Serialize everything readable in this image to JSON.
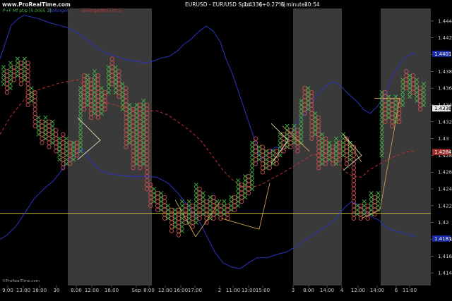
{
  "header": {
    "site": "www.ProRealTime.com",
    "title": "EURUSD - EUR/USD Spot",
    "price": "1.4336",
    "change": "(+0.27%)",
    "interval": "5 minutes",
    "time": "20:54"
  },
  "legend": {
    "pf": "P+F Mf pt/p [0.0005 3]",
    "bands": "Bollinger ...",
    "mid": "BollingerMid [20.2]"
  },
  "watermark": "©ProRealTime.com",
  "colors": {
    "x_mark": "#4ab44a",
    "o_mark": "#c85050",
    "upper_band": "#2a34c0",
    "lower_band": "#2a34c0",
    "mid_band": "#c03030",
    "shade": "#3a3a3a",
    "hline": "#b8b23a",
    "trendline": "#c8a050",
    "wedge": "#d8d8a8"
  },
  "chart_data": {
    "type": "point-and-figure",
    "ylim": [
      1.4125,
      1.4455
    ],
    "yticks": [
      1.414,
      1.416,
      1.418,
      1.42,
      1.422,
      1.424,
      1.426,
      1.428,
      1.43,
      1.432,
      1.434,
      1.436,
      1.438,
      1.44,
      1.442,
      1.444
    ],
    "ytick_labels": [
      "1.414",
      "1.416",
      "1.418",
      "1.42",
      "1.422",
      "1.424",
      "1.426",
      "1.428",
      "1.43",
      "1.432",
      "1.434",
      "1.436",
      "1.438",
      "1.44",
      "1.442",
      "1.444"
    ],
    "xlabels": [
      "9:00",
      "13:00",
      "18:00",
      "30",
      "8:00",
      "12:00",
      "16:00",
      "Sep",
      "8:00",
      "12:00",
      "16:00",
      "17:00",
      "2",
      "11:00",
      "13:00",
      "15:00",
      "3",
      "8:00",
      "14:00",
      "4",
      "12:00",
      "14:00",
      "6",
      "11:00"
    ],
    "price_labels": {
      "upper_band": "1.4401",
      "last": "1.4336",
      "mid": "1.4284",
      "lower_band": "1.4181"
    },
    "hline": 1.4211,
    "box": 0.0005,
    "columns": [
      {
        "t": "X",
        "lo": 1.4365,
        "hi": 1.4385
      },
      {
        "t": "O",
        "lo": 1.4355,
        "hi": 1.438
      },
      {
        "t": "X",
        "lo": 1.436,
        "hi": 1.439
      },
      {
        "t": "O",
        "lo": 1.437,
        "hi": 1.4385
      },
      {
        "t": "X",
        "lo": 1.4375,
        "hi": 1.4395
      },
      {
        "t": "O",
        "lo": 1.4365,
        "hi": 1.439
      },
      {
        "t": "X",
        "lo": 1.437,
        "hi": 1.4395
      },
      {
        "t": "O",
        "lo": 1.434,
        "hi": 1.439
      },
      {
        "t": "X",
        "lo": 1.4345,
        "hi": 1.436
      },
      {
        "t": "O",
        "lo": 1.4315,
        "hi": 1.4355
      },
      {
        "t": "X",
        "lo": 1.4305,
        "hi": 1.4325
      },
      {
        "t": "O",
        "lo": 1.4295,
        "hi": 1.432
      },
      {
        "t": "X",
        "lo": 1.43,
        "hi": 1.4325
      },
      {
        "t": "O",
        "lo": 1.429,
        "hi": 1.432
      },
      {
        "t": "X",
        "lo": 1.4295,
        "hi": 1.432
      },
      {
        "t": "O",
        "lo": 1.4285,
        "hi": 1.431
      },
      {
        "t": "X",
        "lo": 1.4275,
        "hi": 1.43
      },
      {
        "t": "O",
        "lo": 1.4265,
        "hi": 1.4305
      },
      {
        "t": "X",
        "lo": 1.427,
        "hi": 1.43
      },
      {
        "t": "O",
        "lo": 1.427,
        "hi": 1.4295
      },
      {
        "t": "X",
        "lo": 1.4275,
        "hi": 1.4295
      },
      {
        "t": "O",
        "lo": 1.428,
        "hi": 1.4295
      },
      {
        "t": "X",
        "lo": 1.4285,
        "hi": 1.436
      },
      {
        "t": "O",
        "lo": 1.4335,
        "hi": 1.4375
      },
      {
        "t": "X",
        "lo": 1.434,
        "hi": 1.4375
      },
      {
        "t": "O",
        "lo": 1.4325,
        "hi": 1.437
      },
      {
        "t": "X",
        "lo": 1.433,
        "hi": 1.438
      },
      {
        "t": "O",
        "lo": 1.4325,
        "hi": 1.4375
      },
      {
        "t": "X",
        "lo": 1.433,
        "hi": 1.436
      },
      {
        "t": "O",
        "lo": 1.4335,
        "hi": 1.4355
      },
      {
        "t": "X",
        "lo": 1.4355,
        "hi": 1.4385
      },
      {
        "t": "O",
        "lo": 1.4365,
        "hi": 1.4395
      },
      {
        "t": "X",
        "lo": 1.4355,
        "hi": 1.4385
      },
      {
        "t": "O",
        "lo": 1.435,
        "hi": 1.438
      },
      {
        "t": "X",
        "lo": 1.4335,
        "hi": 1.4365
      },
      {
        "t": "O",
        "lo": 1.429,
        "hi": 1.436
      },
      {
        "t": "X",
        "lo": 1.4295,
        "hi": 1.434
      },
      {
        "t": "O",
        "lo": 1.4265,
        "hi": 1.4335
      },
      {
        "t": "X",
        "lo": 1.427,
        "hi": 1.434
      },
      {
        "t": "O",
        "lo": 1.4265,
        "hi": 1.434
      },
      {
        "t": "X",
        "lo": 1.427,
        "hi": 1.4345
      },
      {
        "t": "O",
        "lo": 1.424,
        "hi": 1.434
      },
      {
        "t": "O",
        "lo": 1.422,
        "hi": 1.4245
      },
      {
        "t": "X",
        "lo": 1.4225,
        "hi": 1.424
      },
      {
        "t": "O",
        "lo": 1.4215,
        "hi": 1.4235
      },
      {
        "t": "X",
        "lo": 1.4215,
        "hi": 1.4235
      },
      {
        "t": "O",
        "lo": 1.4205,
        "hi": 1.423
      },
      {
        "t": "X",
        "lo": 1.4205,
        "hi": 1.422
      },
      {
        "t": "O",
        "lo": 1.419,
        "hi": 1.4215
      },
      {
        "t": "X",
        "lo": 1.4195,
        "hi": 1.4215
      },
      {
        "t": "O",
        "lo": 1.4185,
        "hi": 1.4215
      },
      {
        "t": "X",
        "lo": 1.419,
        "hi": 1.4225
      },
      {
        "t": "O",
        "lo": 1.42,
        "hi": 1.422
      },
      {
        "t": "X",
        "lo": 1.42,
        "hi": 1.4225
      },
      {
        "t": "O",
        "lo": 1.4195,
        "hi": 1.422
      },
      {
        "t": "X",
        "lo": 1.42,
        "hi": 1.4245
      },
      {
        "t": "O",
        "lo": 1.4205,
        "hi": 1.424
      },
      {
        "t": "X",
        "lo": 1.421,
        "hi": 1.4235
      },
      {
        "t": "O",
        "lo": 1.42,
        "hi": 1.4225
      },
      {
        "t": "X",
        "lo": 1.4205,
        "hi": 1.423
      },
      {
        "t": "O",
        "lo": 1.4205,
        "hi": 1.423
      },
      {
        "t": "X",
        "lo": 1.421,
        "hi": 1.4225
      },
      {
        "t": "O",
        "lo": 1.4205,
        "hi": 1.422
      },
      {
        "t": "X",
        "lo": 1.421,
        "hi": 1.4225
      },
      {
        "t": "O",
        "lo": 1.4205,
        "hi": 1.422
      },
      {
        "t": "X",
        "lo": 1.4215,
        "hi": 1.423
      },
      {
        "t": "O",
        "lo": 1.4215,
        "hi": 1.423
      },
      {
        "t": "X",
        "lo": 1.422,
        "hi": 1.425
      },
      {
        "t": "O",
        "lo": 1.4225,
        "hi": 1.4245
      },
      {
        "t": "X",
        "lo": 1.423,
        "hi": 1.4255
      },
      {
        "t": "O",
        "lo": 1.4235,
        "hi": 1.4255
      },
      {
        "t": "X",
        "lo": 1.424,
        "hi": 1.4295
      },
      {
        "t": "O",
        "lo": 1.427,
        "hi": 1.43
      },
      {
        "t": "X",
        "lo": 1.4275,
        "hi": 1.429
      },
      {
        "t": "O",
        "lo": 1.426,
        "hi": 1.429
      },
      {
        "t": "X",
        "lo": 1.4265,
        "hi": 1.4285
      },
      {
        "t": "O",
        "lo": 1.4265,
        "hi": 1.4285
      },
      {
        "t": "X",
        "lo": 1.427,
        "hi": 1.4285
      },
      {
        "t": "O",
        "lo": 1.427,
        "hi": 1.4285
      },
      {
        "t": "X",
        "lo": 1.428,
        "hi": 1.4305
      },
      {
        "t": "O",
        "lo": 1.4285,
        "hi": 1.4305
      },
      {
        "t": "X",
        "lo": 1.429,
        "hi": 1.4315
      },
      {
        "t": "O",
        "lo": 1.429,
        "hi": 1.431
      },
      {
        "t": "X",
        "lo": 1.4295,
        "hi": 1.4315
      },
      {
        "t": "O",
        "lo": 1.4285,
        "hi": 1.431
      },
      {
        "t": "X",
        "lo": 1.4295,
        "hi": 1.4345
      },
      {
        "t": "O",
        "lo": 1.433,
        "hi": 1.436
      },
      {
        "t": "X",
        "lo": 1.4335,
        "hi": 1.436
      },
      {
        "t": "O",
        "lo": 1.43,
        "hi": 1.4355
      },
      {
        "t": "X",
        "lo": 1.4305,
        "hi": 1.433
      },
      {
        "t": "O",
        "lo": 1.4265,
        "hi": 1.4325
      },
      {
        "t": "X",
        "lo": 1.427,
        "hi": 1.4305
      },
      {
        "t": "O",
        "lo": 1.427,
        "hi": 1.43
      },
      {
        "t": "X",
        "lo": 1.4275,
        "hi": 1.4295
      },
      {
        "t": "O",
        "lo": 1.427,
        "hi": 1.429
      },
      {
        "t": "X",
        "lo": 1.427,
        "hi": 1.43
      },
      {
        "t": "O",
        "lo": 1.4275,
        "hi": 1.4295
      },
      {
        "t": "X",
        "lo": 1.428,
        "hi": 1.4305
      },
      {
        "t": "O",
        "lo": 1.427,
        "hi": 1.43
      },
      {
        "t": "X",
        "lo": 1.4275,
        "hi": 1.4295
      },
      {
        "t": "O",
        "lo": 1.4205,
        "hi": 1.429
      },
      {
        "t": "X",
        "lo": 1.421,
        "hi": 1.422
      },
      {
        "t": "O",
        "lo": 1.4205,
        "hi": 1.422
      },
      {
        "t": "X",
        "lo": 1.421,
        "hi": 1.4225
      },
      {
        "t": "O",
        "lo": 1.4205,
        "hi": 1.422
      },
      {
        "t": "X",
        "lo": 1.421,
        "hi": 1.4235
      },
      {
        "t": "O",
        "lo": 1.421,
        "hi": 1.423
      },
      {
        "t": "X",
        "lo": 1.4215,
        "hi": 1.4235
      },
      {
        "t": "X",
        "lo": 1.428,
        "hi": 1.4355
      },
      {
        "t": "O",
        "lo": 1.432,
        "hi": 1.4355
      },
      {
        "t": "X",
        "lo": 1.4325,
        "hi": 1.435
      },
      {
        "t": "O",
        "lo": 1.4315,
        "hi": 1.4345
      },
      {
        "t": "X",
        "lo": 1.432,
        "hi": 1.435
      },
      {
        "t": "O",
        "lo": 1.432,
        "hi": 1.4345
      },
      {
        "t": "X",
        "lo": 1.434,
        "hi": 1.437
      },
      {
        "t": "O",
        "lo": 1.436,
        "hi": 1.438
      },
      {
        "t": "X",
        "lo": 1.435,
        "hi": 1.4375
      },
      {
        "t": "O",
        "lo": 1.4355,
        "hi": 1.4375
      },
      {
        "t": "X",
        "lo": 1.4345,
        "hi": 1.437
      },
      {
        "t": "O",
        "lo": 1.4335,
        "hi": 1.436
      },
      {
        "t": "X",
        "lo": 1.434,
        "hi": 1.4365
      }
    ],
    "upper_band": [
      [
        0,
        1.4395
      ],
      [
        8,
        1.4415
      ],
      [
        16,
        1.4435
      ],
      [
        26,
        1.4443
      ],
      [
        34,
        1.4447
      ],
      [
        44,
        1.4445
      ],
      [
        54,
        1.4443
      ],
      [
        64,
        1.444
      ],
      [
        74,
        1.4437
      ],
      [
        84,
        1.4435
      ],
      [
        96,
        1.4432
      ],
      [
        110,
        1.4426
      ],
      [
        124,
        1.4417
      ],
      [
        138,
        1.4408
      ],
      [
        150,
        1.4402
      ],
      [
        164,
        1.4398
      ],
      [
        178,
        1.4394
      ],
      [
        194,
        1.4392
      ],
      [
        206,
        1.439
      ],
      [
        216,
        1.4392
      ],
      [
        228,
        1.4396
      ],
      [
        240,
        1.4398
      ],
      [
        252,
        1.4405
      ],
      [
        260,
        1.4412
      ],
      [
        270,
        1.4418
      ],
      [
        282,
        1.4428
      ],
      [
        292,
        1.4434
      ],
      [
        302,
        1.4428
      ],
      [
        312,
        1.4415
      ],
      [
        320,
        1.4395
      ],
      [
        330,
        1.4375
      ],
      [
        340,
        1.435
      ],
      [
        350,
        1.4325
      ],
      [
        360,
        1.43
      ],
      [
        370,
        1.4275
      ],
      [
        380,
        1.4282
      ],
      [
        390,
        1.429
      ],
      [
        400,
        1.4288
      ],
      [
        410,
        1.4302
      ],
      [
        420,
        1.4318
      ],
      [
        430,
        1.4328
      ],
      [
        440,
        1.4342
      ],
      [
        450,
        1.4352
      ],
      [
        460,
        1.4362
      ],
      [
        470,
        1.4367
      ],
      [
        480,
        1.4365
      ],
      [
        490,
        1.4356
      ],
      [
        500,
        1.4348
      ],
      [
        508,
        1.4342
      ],
      [
        514,
        1.4335
      ],
      [
        524,
        1.433
      ],
      [
        534,
        1.4338
      ],
      [
        544,
        1.435
      ],
      [
        554,
        1.4372
      ],
      [
        564,
        1.4386
      ],
      [
        574,
        1.4397
      ],
      [
        582,
        1.4401
      ],
      [
        588,
        1.4401
      ]
    ],
    "mid_band": [
      [
        0,
        1.4305
      ],
      [
        14,
        1.4325
      ],
      [
        28,
        1.434
      ],
      [
        40,
        1.4352
      ],
      [
        54,
        1.4358
      ],
      [
        68,
        1.4362
      ],
      [
        80,
        1.4365
      ],
      [
        96,
        1.4368
      ],
      [
        110,
        1.437
      ],
      [
        124,
        1.4362
      ],
      [
        138,
        1.435
      ],
      [
        150,
        1.4343
      ],
      [
        164,
        1.434
      ],
      [
        176,
        1.4337
      ],
      [
        190,
        1.4334
      ],
      [
        206,
        1.4333
      ],
      [
        222,
        1.4333
      ],
      [
        238,
        1.4328
      ],
      [
        252,
        1.432
      ],
      [
        268,
        1.431
      ],
      [
        284,
        1.4298
      ],
      [
        300,
        1.428
      ],
      [
        316,
        1.4262
      ],
      [
        330,
        1.425
      ],
      [
        344,
        1.4243
      ],
      [
        356,
        1.4242
      ],
      [
        370,
        1.4245
      ],
      [
        384,
        1.4252
      ],
      [
        398,
        1.4258
      ],
      [
        412,
        1.4265
      ],
      [
        426,
        1.4272
      ],
      [
        440,
        1.428
      ],
      [
        454,
        1.4282
      ],
      [
        466,
        1.4282
      ],
      [
        478,
        1.4272
      ],
      [
        490,
        1.426
      ],
      [
        500,
        1.4255
      ],
      [
        512,
        1.4254
      ],
      [
        522,
        1.4262
      ],
      [
        534,
        1.4268
      ],
      [
        548,
        1.4275
      ],
      [
        562,
        1.428
      ],
      [
        576,
        1.4284
      ],
      [
        588,
        1.4285
      ]
    ],
    "lower_band": [
      [
        0,
        1.418
      ],
      [
        10,
        1.4185
      ],
      [
        22,
        1.4195
      ],
      [
        34,
        1.421
      ],
      [
        48,
        1.4228
      ],
      [
        62,
        1.424
      ],
      [
        76,
        1.425
      ],
      [
        90,
        1.4265
      ],
      [
        102,
        1.4278
      ],
      [
        116,
        1.4288
      ],
      [
        130,
        1.4272
      ],
      [
        142,
        1.4262
      ],
      [
        156,
        1.4258
      ],
      [
        172,
        1.4256
      ],
      [
        190,
        1.4255
      ],
      [
        206,
        1.4255
      ],
      [
        222,
        1.4254
      ],
      [
        238,
        1.4247
      ],
      [
        252,
        1.4235
      ],
      [
        266,
        1.422
      ],
      [
        280,
        1.4205
      ],
      [
        292,
        1.4185
      ],
      [
        304,
        1.4165
      ],
      [
        316,
        1.4152
      ],
      [
        328,
        1.4147
      ],
      [
        340,
        1.4145
      ],
      [
        352,
        1.4152
      ],
      [
        364,
        1.4158
      ],
      [
        378,
        1.4158
      ],
      [
        392,
        1.4162
      ],
      [
        406,
        1.4165
      ],
      [
        420,
        1.4172
      ],
      [
        434,
        1.418
      ],
      [
        448,
        1.4188
      ],
      [
        462,
        1.4195
      ],
      [
        476,
        1.4205
      ],
      [
        488,
        1.4218
      ],
      [
        498,
        1.4225
      ],
      [
        506,
        1.4222
      ],
      [
        516,
        1.4213
      ],
      [
        526,
        1.4207
      ],
      [
        536,
        1.4203
      ],
      [
        548,
        1.4193
      ],
      [
        560,
        1.419
      ],
      [
        572,
        1.4187
      ],
      [
        582,
        1.4185
      ],
      [
        588,
        1.4183
      ]
    ],
    "trendlines": [
      {
        "pts": [
          [
            248,
            1.4227
          ],
          [
            277,
            1.4183
          ]
        ]
      },
      {
        "pts": [
          [
            277,
            1.4183
          ],
          [
            313,
            1.4227
          ]
        ]
      },
      {
        "pts": [
          [
            313,
            1.4205
          ],
          [
            367,
            1.4192
          ]
        ]
      },
      {
        "pts": [
          [
            367,
            1.4192
          ],
          [
            382,
            1.4247
          ]
        ]
      },
      {
        "pts": [
          [
            400,
            1.4315
          ],
          [
            438,
            1.4285
          ]
        ]
      },
      {
        "pts": [
          [
            486,
            1.4305
          ],
          [
            512,
            1.4272
          ]
        ]
      },
      {
        "pts": [
          [
            512,
            1.4205
          ],
          [
            538,
            1.4215
          ]
        ]
      },
      {
        "pts": [
          [
            538,
            1.4215
          ],
          [
            566,
            1.4348
          ]
        ]
      },
      {
        "pts": [
          [
            530,
            1.4348
          ],
          [
            566,
            1.4348
          ]
        ]
      }
    ],
    "wedges": [
      {
        "pts": [
          [
            110,
            1.4325
          ],
          [
            142,
            1.4298
          ],
          [
            110,
            1.4275
          ]
        ]
      },
      {
        "pts": [
          [
            384,
            1.4318
          ],
          [
            408,
            1.4298
          ],
          [
            384,
            1.427
          ]
        ]
      },
      {
        "pts": [
          [
            486,
            1.4305
          ],
          [
            512,
            1.428
          ],
          [
            486,
            1.4262
          ]
        ]
      }
    ]
  }
}
